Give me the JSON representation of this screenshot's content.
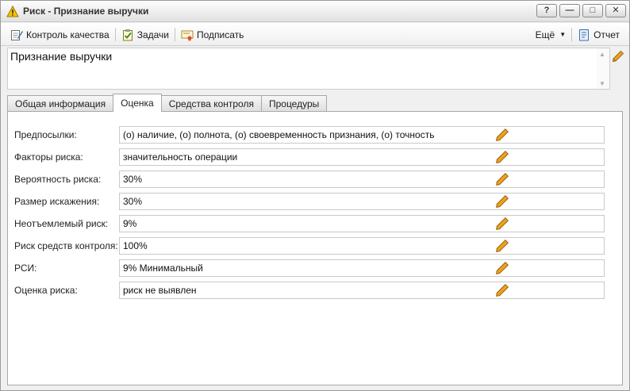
{
  "window": {
    "title": "Риск - Признание выручки",
    "buttons": {
      "help": "?",
      "minimize": "—",
      "maximize": "□",
      "close": "✕"
    }
  },
  "toolbar": {
    "quality_control": "Контроль качества",
    "tasks": "Задачи",
    "sign": "Подписать",
    "more": "Ещё",
    "report": "Отчет"
  },
  "record": {
    "name": "Признание выручки"
  },
  "tabs": [
    {
      "label": "Общая информация",
      "active": false
    },
    {
      "label": "Оценка",
      "active": true
    },
    {
      "label": "Средства контроля",
      "active": false
    },
    {
      "label": "Процедуры",
      "active": false
    }
  ],
  "fields": [
    {
      "label": "Предпосылки:",
      "value": "(о) наличие, (о) полнота, (о) своевременность признания, (о) точность"
    },
    {
      "label": "Факторы риска:",
      "value": "значительность операции"
    },
    {
      "label": "Вероятность риска:",
      "value": "30%"
    },
    {
      "label": "Размер искажения:",
      "value": "30%"
    },
    {
      "label": "Неотъемлемый риск:",
      "value": "9%"
    },
    {
      "label": "Риск средств контроля:",
      "value": "100%"
    },
    {
      "label": "РСИ:",
      "value": "9% Минимальный"
    },
    {
      "label": "Оценка риска:",
      "value": "риск не выявлен"
    }
  ],
  "colors": {
    "pencil": "#f0a020",
    "accent_blue": "#3b6fb6",
    "warning_yellow": "#f5c400"
  },
  "icons": [
    "warning-icon",
    "quality-control-icon",
    "tasks-icon",
    "sign-icon",
    "report-icon",
    "pencil-icon"
  ]
}
